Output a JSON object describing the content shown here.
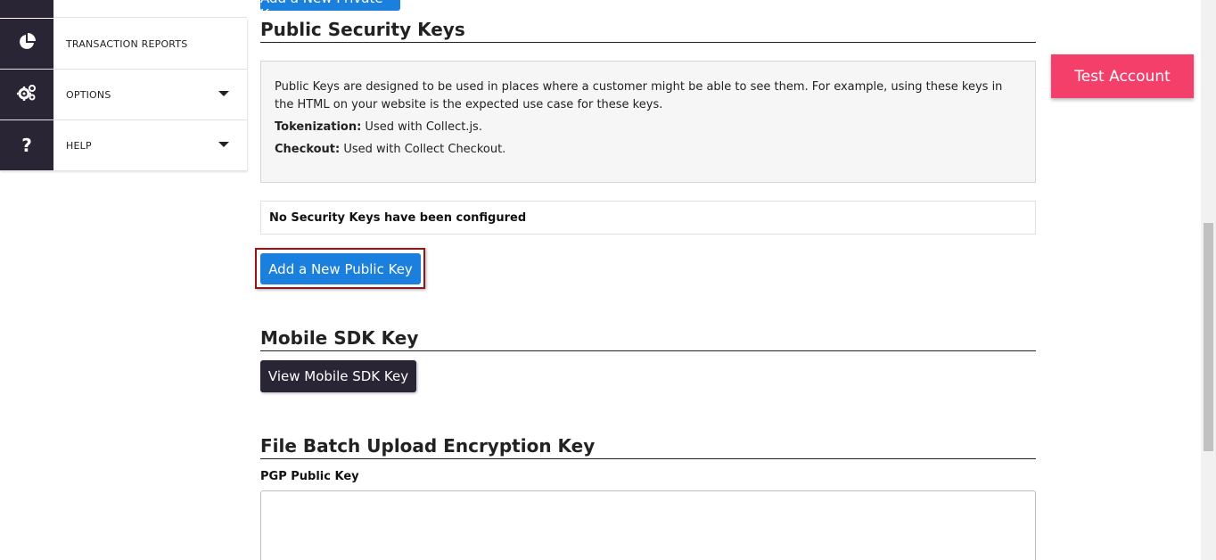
{
  "sidebar": {
    "items": [
      {
        "label": "TRANSACTION REPORTS",
        "icon": "pie-chart-icon",
        "has_caret": false
      },
      {
        "label": "OPTIONS",
        "icon": "gears-icon",
        "has_caret": true
      },
      {
        "label": "HELP",
        "icon": "question-icon",
        "has_caret": true
      }
    ]
  },
  "private_keys": {
    "add_button_label": "Add a New Private Key"
  },
  "public_keys": {
    "title": "Public Security Keys",
    "description": "Public Keys are designed to be used in places where a customer might be able to see them. For example, using these keys in the HTML on your website is the expected use case for these keys.",
    "tokenization_label": "Tokenization:",
    "tokenization_text": " Used with Collect.js.",
    "checkout_label": "Checkout:",
    "checkout_text": " Used with Collect Checkout.",
    "empty_message": "No Security Keys have been configured",
    "add_button_label": "Add a New Public Key"
  },
  "mobile_sdk": {
    "title": "Mobile SDK Key",
    "view_button_label": "View Mobile SDK Key"
  },
  "file_batch": {
    "title": "File Batch Upload Encryption Key",
    "field_label": "PGP Public Key",
    "field_value": ""
  },
  "test_account": {
    "label": "Test Account"
  },
  "colors": {
    "primary_blue": "#1b7fde",
    "dark": "#2a2535",
    "test_pink": "#f43f6a",
    "highlight_red": "#8b1a1a"
  }
}
